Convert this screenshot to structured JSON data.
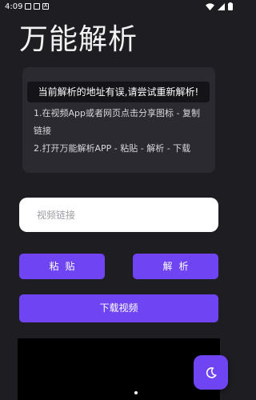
{
  "status_bar": {
    "time": "4:09",
    "notif_icon_letter": "A"
  },
  "app": {
    "title": "万能解析"
  },
  "info": {
    "error_message": "当前解析的地址有误,请尝试重新解析!",
    "step1_line1": "1.在视频App或者网页点击分享图标 - 复制",
    "step1_line2": "链接",
    "step2": "2.打开万能解析APP - 粘贴 - 解析 - 下载"
  },
  "link_input": {
    "placeholder": "视频链接",
    "value": ""
  },
  "buttons": {
    "paste": "粘贴",
    "parse": "解析",
    "download": "下载视频"
  },
  "colors": {
    "accent": "#6f44f2",
    "background": "#1e1d22",
    "card": "#2a2a30"
  },
  "icons": {
    "fab": "moon-icon",
    "wifi": "wifi-icon",
    "signal": "signal-icon",
    "battery": "battery-icon"
  }
}
